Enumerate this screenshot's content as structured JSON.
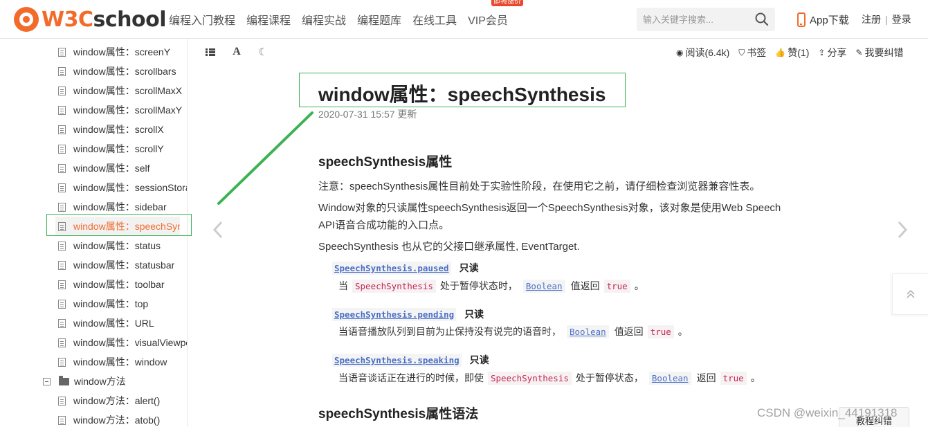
{
  "header": {
    "logo": {
      "w3c": "W3C",
      "school": "school"
    },
    "nav": [
      {
        "label": "编程入门教程"
      },
      {
        "label": "编程课程"
      },
      {
        "label": "编程实战"
      },
      {
        "label": "编程题库"
      },
      {
        "label": "在线工具"
      },
      {
        "label": "VIP会员",
        "badge": "即将涨价"
      }
    ],
    "search_placeholder": "输入关键字搜索...",
    "app_download": "App下载",
    "register": "注册",
    "separator": "|",
    "login": "登录"
  },
  "sidebar": {
    "items": [
      {
        "label": "window属性：screenY"
      },
      {
        "label": "window属性：scrollbars"
      },
      {
        "label": "window属性：scrollMaxX"
      },
      {
        "label": "window属性：scrollMaxY"
      },
      {
        "label": "window属性：scrollX"
      },
      {
        "label": "window属性：scrollY"
      },
      {
        "label": "window属性：self"
      },
      {
        "label": "window属性：sessionStorage"
      },
      {
        "label": "window属性：sidebar"
      },
      {
        "label": "window属性：speechSynthesis",
        "active": true
      },
      {
        "label": "window属性：status"
      },
      {
        "label": "window属性：statusbar"
      },
      {
        "label": "window属性：toolbar"
      },
      {
        "label": "window属性：top"
      },
      {
        "label": "window属性：URL"
      },
      {
        "label": "window属性：visualViewport"
      },
      {
        "label": "window属性：window"
      }
    ],
    "folder": {
      "label": "window方法"
    },
    "method_items": [
      {
        "label": "window方法：alert()"
      },
      {
        "label": "window方法：atob()"
      }
    ]
  },
  "toolbar": {
    "read": "阅读(6.4k)",
    "bookmark": "书签",
    "like": "赞(1)",
    "share": "分享",
    "report": "我要纠错"
  },
  "article": {
    "title": "window属性：speechSynthesis",
    "updated": "2020-07-31 15:57 更新",
    "section1_heading": "speechSynthesis属性",
    "note": "注意：speechSynthesis属性目前处于实验性阶段，在使用它之前，请仔细检查浏览器兼容性表。",
    "desc_line1": "Window对象的只读属性speechSynthesis返回一个SpeechSynthesis对象，该对象是使用Web Speech",
    "desc_line2": "API语音合成功能的入口点。",
    "inherit": "SpeechSynthesis 也从它的父接口继承属性, EventTarget.",
    "read_only": "只读",
    "defs": [
      {
        "term": "SpeechSynthesis.paused",
        "d1": "当",
        "code1": "SpeechSynthesis",
        "d2": "处于暂停状态时，",
        "code2": "Boolean",
        "d3": "值返回",
        "code3": "true",
        "d4": "。"
      },
      {
        "term": "SpeechSynthesis.pending",
        "d1": "当语音播放队列到目前为止保持没有说完的语音时，",
        "code2": "Boolean",
        "d3": "值返回",
        "code3": "true",
        "d4": "。"
      },
      {
        "term": "SpeechSynthesis.speaking",
        "d1": "当语音谈话正在进行的时候，即使",
        "code1": "SpeechSynthesis",
        "d2": "处于暂停状态，",
        "code2": "Boolean",
        "d3": "返回",
        "code3": "true",
        "d4": "。"
      }
    ],
    "section2_heading": "speechSynthesis属性语法"
  },
  "watermark": "CSDN @weixin_44191318",
  "feedback": "教程纠错",
  "colors": {
    "brand": "#f26b2a",
    "highlight": "#3cb254",
    "link": "#4a6fc7",
    "code_red": "#c7254e"
  }
}
